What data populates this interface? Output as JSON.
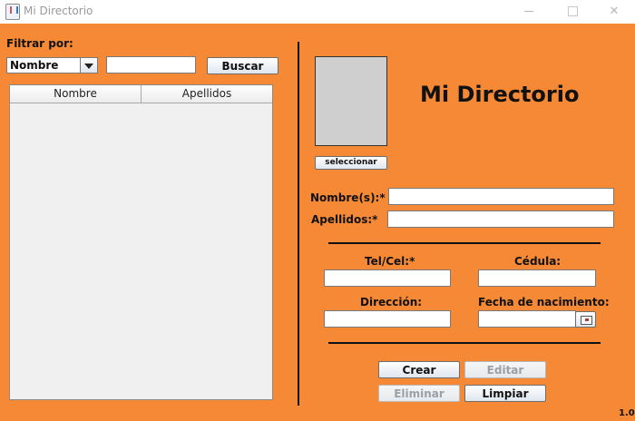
{
  "window": {
    "title": "Mi Directorio",
    "icon": "java-cup-icon",
    "controls": [
      "minimize-icon",
      "maximize-icon",
      "close-icon"
    ]
  },
  "filter": {
    "label": "Filtrar por:",
    "combo_value": "Nombre",
    "search_value": "",
    "search_button": "Buscar"
  },
  "table": {
    "columns": [
      "Nombre",
      "Apellidos"
    ],
    "rows": []
  },
  "form": {
    "app_title": "Mi Directorio",
    "photo_button": "seleccionar",
    "nombre_label": "Nombre(s):*",
    "nombre_value": "",
    "apellidos_label": "Apellidos:*",
    "apellidos_value": "",
    "tel_label": "Tel/Cel:*",
    "tel_value": "",
    "cedula_label": "Cédula:",
    "cedula_value": "",
    "direccion_label": "Dirección:",
    "direccion_value": "",
    "fecha_label": "Fecha de nacimiento:",
    "fecha_value": ""
  },
  "actions": {
    "crear": "Crear",
    "editar": "Editar",
    "eliminar": "Eliminar",
    "limpiar": "Limpiar"
  },
  "version": "1.0",
  "colors": {
    "background": "#f58935",
    "separator": "#111111",
    "photo_placeholder": "#cfcfcf"
  }
}
